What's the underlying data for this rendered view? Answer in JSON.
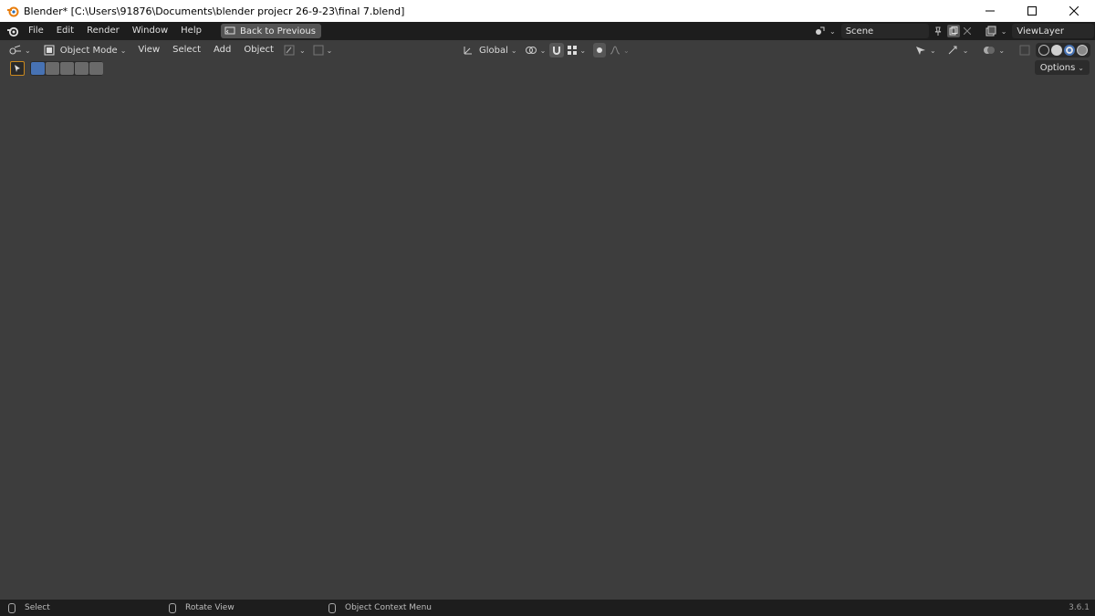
{
  "window": {
    "title": "Blender* [C:\\Users\\91876\\Documents\\blender projecr 26-9-23\\final 7.blend]",
    "controls": [
      "minimize",
      "maximize",
      "close"
    ]
  },
  "menu": {
    "items": [
      "File",
      "Edit",
      "Render",
      "Window",
      "Help"
    ],
    "back_button": "Back to Previous"
  },
  "scene": {
    "scene_name": "Scene",
    "view_layer": "ViewLayer"
  },
  "viewport_header": {
    "mode": "Object Mode",
    "menus": [
      "View",
      "Select",
      "Add",
      "Object"
    ],
    "transform_orientation": "Global",
    "options": "Options"
  },
  "statusbar": {
    "select": "Select",
    "rotate": "Rotate View",
    "context_menu": "Object Context Menu",
    "version": "3.6.1"
  },
  "colors": {
    "accent_orange": "#ff7a1a",
    "active_blue": "#4772b3",
    "header_bg": "#1d1d1d",
    "viewport_bg": "#3d3d3d"
  }
}
